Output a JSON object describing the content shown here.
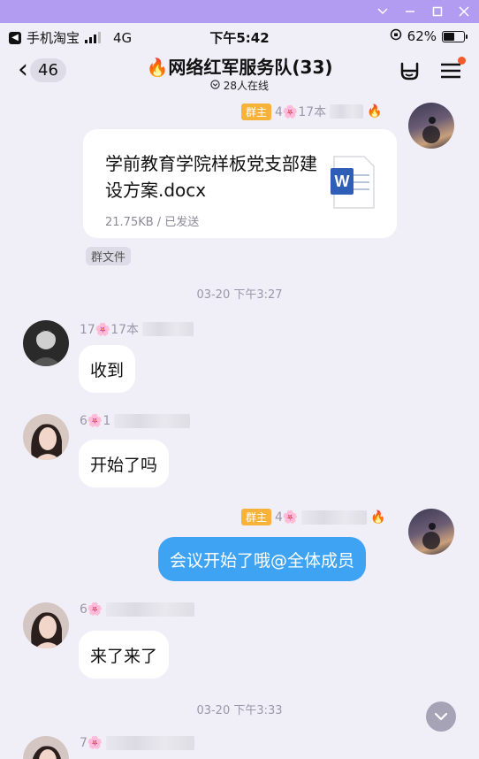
{
  "status": {
    "back_app": "手机淘宝",
    "network": "4G",
    "time": "下午5:42",
    "battery": "62%",
    "battery_level": 0.62
  },
  "header": {
    "back_count": "46",
    "title_emoji": "🔥",
    "title": "网络红军服务队(33)",
    "online": "28人在线"
  },
  "messages": {
    "m1": {
      "role": "群主",
      "sender": "4🌸17本",
      "emoji": "🔥",
      "file_name": "学前教育学院样板党支部建设方案.docx",
      "file_info": "21.75KB / 已发送",
      "tag": "群文件"
    },
    "t1": "03-20 下午3:27",
    "m2": {
      "sender": "17🌸17本",
      "text": "收到"
    },
    "m3": {
      "sender": "6🌸1",
      "text": "开始了吗"
    },
    "m4": {
      "role": "群主",
      "sender": "4🌸",
      "emoji": "🔥",
      "text": "会议开始了哦@全体成员"
    },
    "m5": {
      "sender": "6🌸",
      "text": "来了来了"
    },
    "t2": "03-20 下午3:33",
    "m6": {
      "sender": "7🌸"
    }
  },
  "colors": {
    "titlebar": "#b19cf1",
    "background": "#f0eef6",
    "outgoing_bubble": "#3ea3f3",
    "owner_badge": "#f7b23a",
    "notify_dot": "#f35a2a"
  },
  "icons": [
    "minimize-icon",
    "maximize-icon",
    "close-icon",
    "back-chevron-icon",
    "rock-hand-icon",
    "menu-icon",
    "word-doc-icon",
    "chevron-down-icon"
  ]
}
